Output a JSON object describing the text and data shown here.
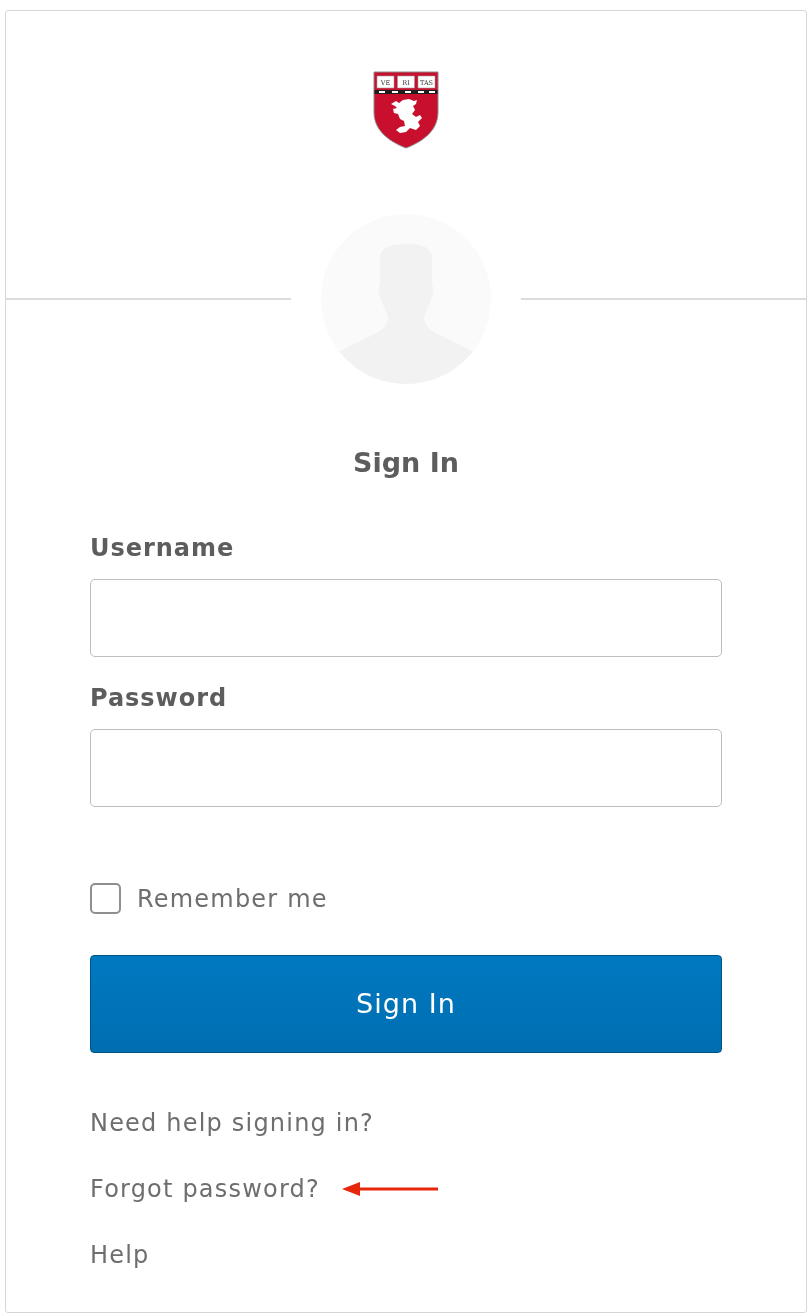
{
  "logo": {
    "motto": [
      "VE",
      "RI",
      "TAS"
    ]
  },
  "heading": "Sign In",
  "fields": [
    {
      "label": "Username"
    },
    {
      "label": "Password"
    }
  ],
  "remember": {
    "label": "Remember me",
    "checked": false
  },
  "submit": "Sign In",
  "links": [
    {
      "text": "Need help signing in?",
      "arrow": false
    },
    {
      "text": "Forgot password?",
      "arrow": true
    },
    {
      "text": "Help",
      "arrow": false
    }
  ]
}
